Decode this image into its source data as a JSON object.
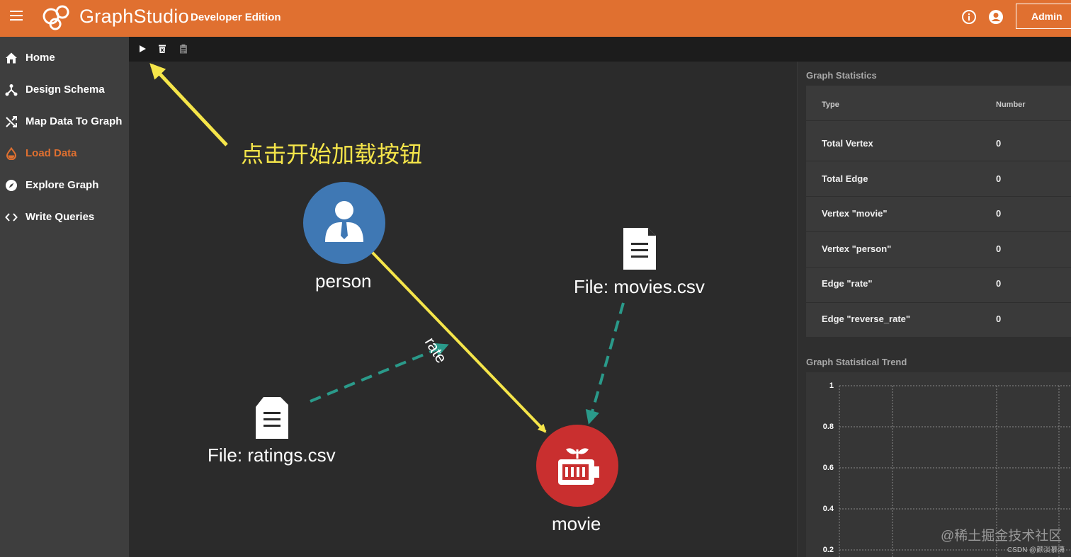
{
  "header": {
    "brand": "GraphStudio",
    "edition": "Developer Edition",
    "admin_label": "Admin",
    "icons": [
      "menu-icon",
      "info-icon",
      "account-icon"
    ]
  },
  "sidebar": {
    "items": [
      {
        "label": "Home",
        "icon": "home-icon",
        "active": false
      },
      {
        "label": "Design Schema",
        "icon": "schema-icon",
        "active": false
      },
      {
        "label": "Map Data To Graph",
        "icon": "shuffle-icon",
        "active": false
      },
      {
        "label": "Load Data",
        "icon": "drop-icon",
        "active": true
      },
      {
        "label": "Explore Graph",
        "icon": "compass-icon",
        "active": false
      },
      {
        "label": "Write Queries",
        "icon": "code-icon",
        "active": false
      }
    ]
  },
  "toolbar": {
    "buttons": [
      "play-icon",
      "delete-icon",
      "clipboard-icon"
    ]
  },
  "canvas": {
    "annotation": "点击开始加载按钮",
    "nodes": {
      "person": "person",
      "movie": "movie",
      "movies_file": "File: movies.csv",
      "ratings_file": "File: ratings.csv"
    },
    "edge_label": "rate"
  },
  "statistics": {
    "title": "Graph Statistics",
    "columns": [
      "Type",
      "Number"
    ],
    "rows": [
      {
        "type": "Total Vertex",
        "number": "0"
      },
      {
        "type": "Total Edge",
        "number": "0"
      },
      {
        "type": "Vertex \"movie\"",
        "number": "0"
      },
      {
        "type": "Vertex \"person\"",
        "number": "0"
      },
      {
        "type": "Edge \"rate\"",
        "number": "0"
      },
      {
        "type": "Edge \"reverse_rate\"",
        "number": "0"
      }
    ]
  },
  "trend": {
    "title": "Graph Statistical Trend",
    "y_ticks": [
      "1",
      "0.8",
      "0.6",
      "0.4",
      "0.2"
    ]
  },
  "watermark": {
    "main": "@稀土掘金技术社区",
    "sub": "CSDN @颜淡慕潇"
  },
  "colors": {
    "header": "#e07030",
    "active_nav": "#e07030",
    "person_node": "#3f78b4",
    "movie_node": "#c92f2f",
    "annotation": "#f5e54a",
    "mapping_edge": "#2a9a8a"
  }
}
